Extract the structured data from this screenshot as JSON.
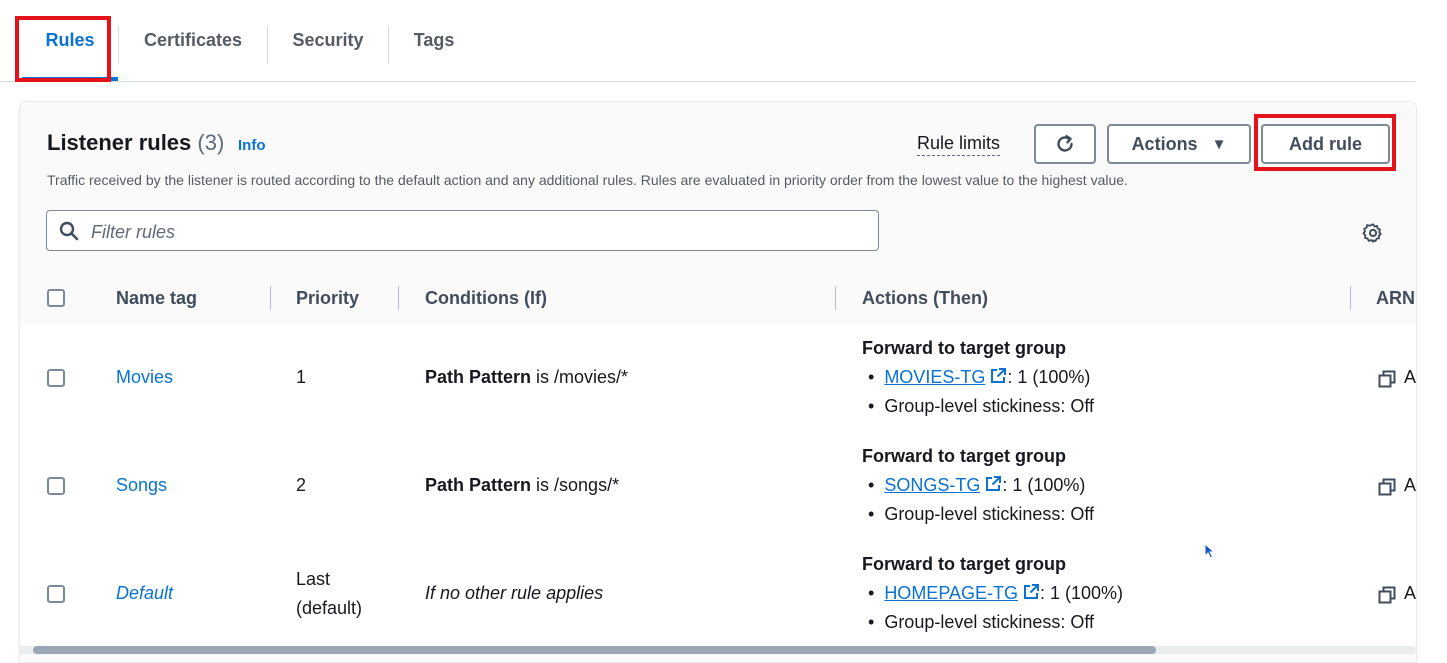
{
  "tabs": [
    {
      "label": "Rules",
      "active": true
    },
    {
      "label": "Certificates",
      "active": false
    },
    {
      "label": "Security",
      "active": false
    },
    {
      "label": "Tags",
      "active": false
    }
  ],
  "panel": {
    "title": "Listener rules",
    "count": "(3)",
    "info": "Info",
    "description": "Traffic received by the listener is routed according to the default action and any additional rules. Rules are evaluated in priority order from the lowest value to the highest value.",
    "rule_limits": "Rule limits",
    "actions_label": "Actions",
    "add_rule_label": "Add rule",
    "filter_placeholder": "Filter rules"
  },
  "table": {
    "headers": {
      "name": "Name tag",
      "priority": "Priority",
      "conditions": "Conditions (If)",
      "actions": "Actions (Then)",
      "arn": "ARN"
    },
    "rows": [
      {
        "name": "Movies",
        "name_italic": false,
        "priority_1": "1",
        "priority_2": "",
        "condition_bold": "Path Pattern",
        "condition_rest": " is /movies/*",
        "condition_italic": "",
        "action_title": "Forward to target group",
        "target_group": "MOVIES-TG",
        "weight": ": 1 (100%)",
        "stickiness": "Group-level stickiness: Off",
        "arn_fragment": "A"
      },
      {
        "name": "Songs",
        "name_italic": false,
        "priority_1": "2",
        "priority_2": "",
        "condition_bold": "Path Pattern",
        "condition_rest": " is /songs/*",
        "condition_italic": "",
        "action_title": "Forward to target group",
        "target_group": "SONGS-TG",
        "weight": ": 1 (100%)",
        "stickiness": "Group-level stickiness: Off",
        "arn_fragment": "A"
      },
      {
        "name": "Default",
        "name_italic": true,
        "priority_1": "Last",
        "priority_2": "(default)",
        "condition_bold": "",
        "condition_rest": "",
        "condition_italic": "If no other rule applies",
        "action_title": "Forward to target group",
        "target_group": "HOMEPAGE-TG",
        "weight": ": 1 (100%)",
        "stickiness": "Group-level stickiness: Off",
        "arn_fragment": "A"
      }
    ]
  },
  "colors": {
    "link": "#0972d3",
    "highlight_box": "#e3121b",
    "text": "#16191f",
    "muted": "#545b64"
  },
  "icons": [
    "search-icon",
    "refresh-icon",
    "caret-down-icon",
    "settings-gear-icon",
    "external-link-icon",
    "copy-icon",
    "mouse-cursor-icon"
  ]
}
